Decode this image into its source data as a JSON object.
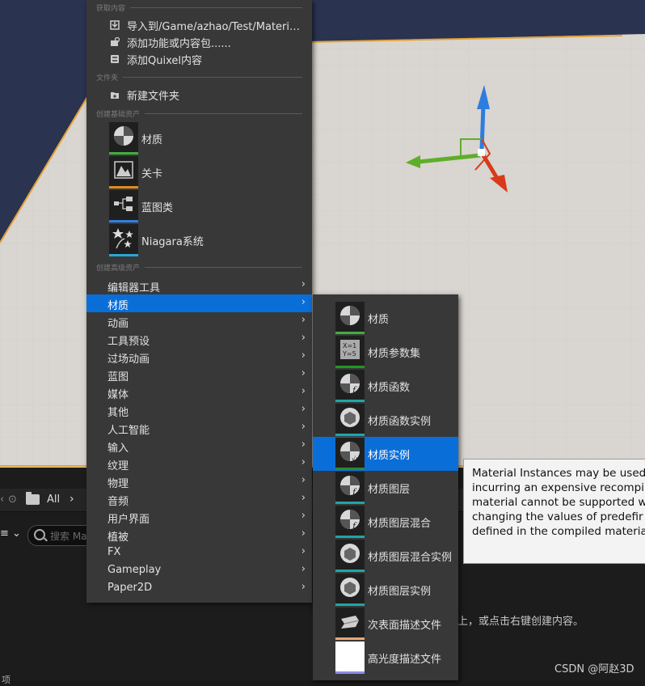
{
  "menu": {
    "sections": {
      "get_content": "获取内容",
      "folder": "文件夹",
      "basic_assets": "创建基础资产",
      "advanced_assets": "创建高级资产"
    },
    "get_content_items": [
      {
        "label": "导入到/Game/azhao/Test/Material......",
        "icon": "import-icon"
      },
      {
        "label": "添加功能或内容包......",
        "icon": "content-pack-icon"
      },
      {
        "label": "添加Quixel内容",
        "icon": "quixel-icon"
      }
    ],
    "folder_items": [
      {
        "label": "新建文件夹",
        "icon": "new-folder-icon"
      }
    ],
    "basic_assets": [
      {
        "label": "材质",
        "icon": "material-icon",
        "color": "#3fae3f"
      },
      {
        "label": "关卡",
        "icon": "level-icon",
        "color": "#e08a1e"
      },
      {
        "label": "蓝图类",
        "icon": "blueprint-icon",
        "color": "#2f7fe0"
      },
      {
        "label": "Niagara系统",
        "icon": "niagara-icon",
        "color": "#28a8d8"
      }
    ],
    "advanced_categories": [
      "编辑器工具",
      "材质",
      "动画",
      "工具预设",
      "过场动画",
      "蓝图",
      "媒体",
      "其他",
      "人工智能",
      "输入",
      "纹理",
      "物理",
      "音频",
      "用户界面",
      "植被",
      "FX",
      "Gameplay",
      "Paper2D"
    ],
    "active_category": "材质"
  },
  "submenu": {
    "items": [
      {
        "label": "材质",
        "icon": "material-icon",
        "color": "#3fae3f"
      },
      {
        "label": "材质参数集",
        "icon": "material-parameter-collection-icon",
        "color": "#1e9a1e"
      },
      {
        "label": "材质函数",
        "icon": "material-function-icon",
        "color": "#1fa5a5"
      },
      {
        "label": "材质函数实例",
        "icon": "material-function-instance-icon",
        "color": "#1fa5a5"
      },
      {
        "label": "材质实例",
        "icon": "material-instance-icon",
        "color": "#2a8a2a"
      },
      {
        "label": "材质图层",
        "icon": "material-layer-icon",
        "color": "#1fa5a5"
      },
      {
        "label": "材质图层混合",
        "icon": "material-layer-blend-icon",
        "color": "#1fa5a5"
      },
      {
        "label": "材质图层混合实例",
        "icon": "material-layer-blend-instance-icon",
        "color": "#1fa5a5"
      },
      {
        "label": "材质图层实例",
        "icon": "material-layer-instance-icon",
        "color": "#1fa5a5"
      },
      {
        "label": "次表面描述文件",
        "icon": "subsurface-profile-icon",
        "color": "#e8a878"
      },
      {
        "label": "高光度描述文件",
        "icon": "specular-profile-icon",
        "color": "#8a8ae8"
      }
    ],
    "active_label": "材质实例"
  },
  "tooltip": {
    "lines": [
      "Material Instances may be used",
      "incurring an expensive recompi",
      "material cannot be supported w",
      "changing the values of predefir",
      "defined in the compiled materia"
    ]
  },
  "content_browser": {
    "breadcrumb_all": "All",
    "search_placeholder": "搜索 Ma",
    "empty_hint": "上，或点击右键创建内容。",
    "item_count": "项"
  },
  "watermark": "CSDN @阿赵3D"
}
